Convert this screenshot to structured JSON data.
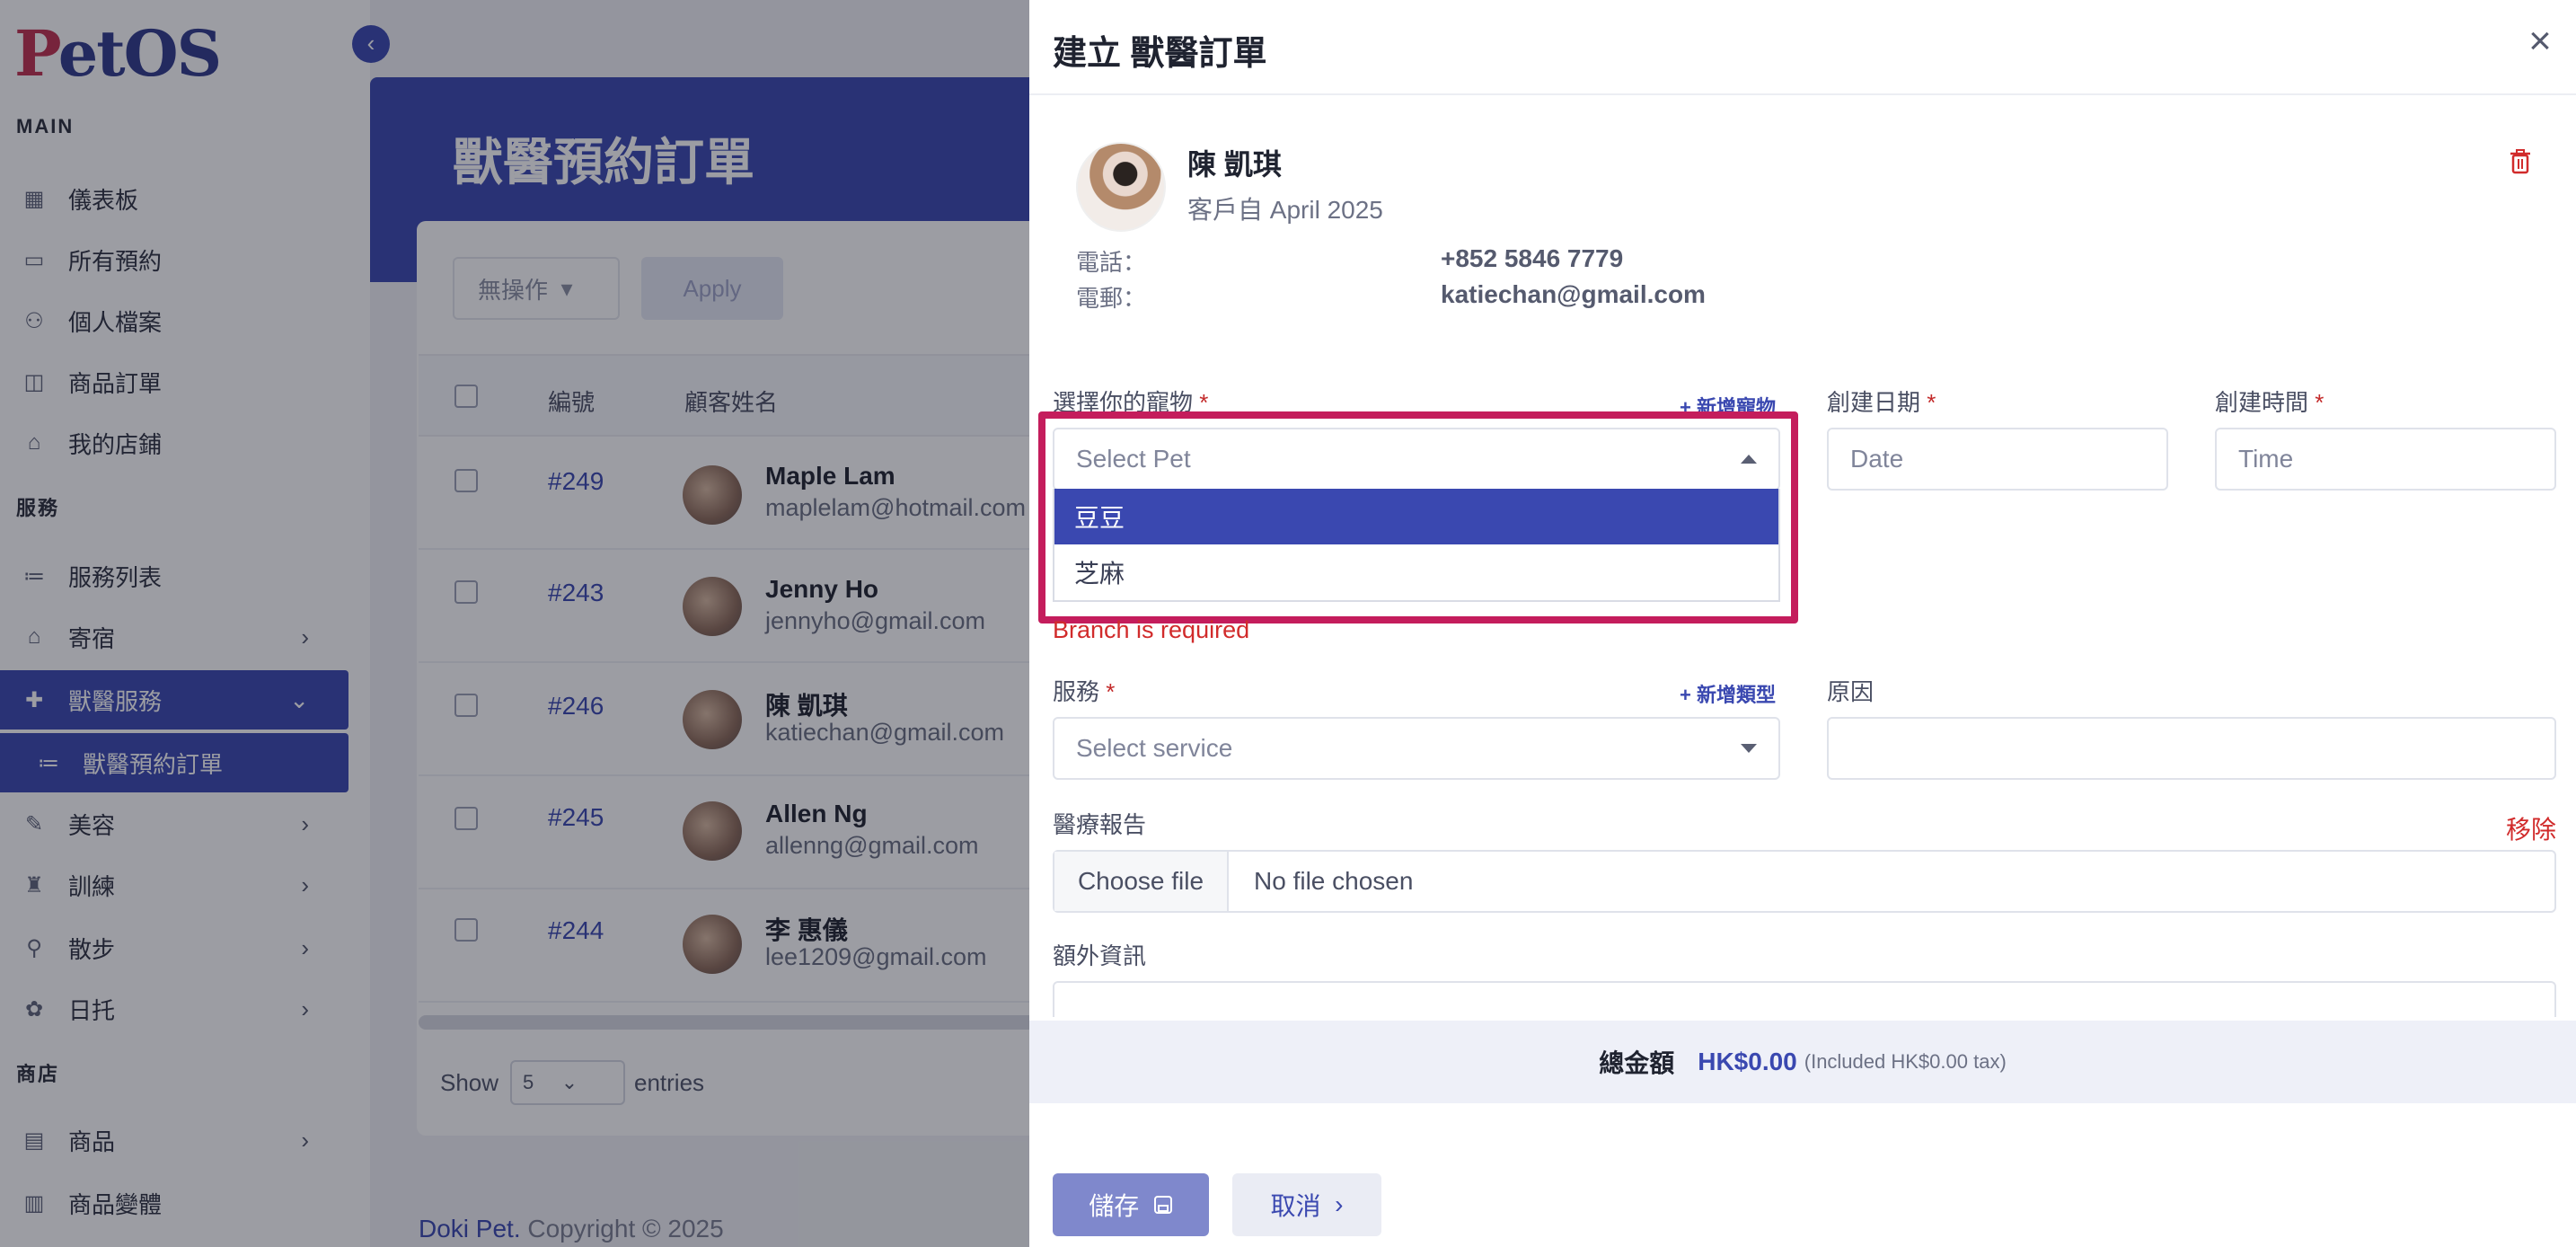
{
  "sidebar": {
    "logo": "PetOS",
    "logo_first": "P",
    "logo_rest": "etOS",
    "sections": {
      "main": "MAIN",
      "services": "服務",
      "shop": "商店"
    },
    "items": [
      {
        "label": "儀表板",
        "icon": "grid-icon"
      },
      {
        "label": "所有預約",
        "icon": "calendar-icon"
      },
      {
        "label": "個人檔案",
        "icon": "user-icon"
      },
      {
        "label": "商品訂單",
        "icon": "bag-icon"
      },
      {
        "label": "我的店鋪",
        "icon": "store-icon"
      },
      {
        "label": "服務列表",
        "icon": "list-icon"
      },
      {
        "label": "寄宿",
        "icon": "home-icon"
      },
      {
        "label": "獸醫服務",
        "icon": "vet-icon"
      },
      {
        "label": "獸醫預約訂單",
        "icon": "list-icon"
      },
      {
        "label": "美容",
        "icon": "brush-icon"
      },
      {
        "label": "訓練",
        "icon": "training-icon"
      },
      {
        "label": "散步",
        "icon": "walk-icon"
      },
      {
        "label": "日托",
        "icon": "daycare-icon"
      },
      {
        "label": "商品",
        "icon": "product-icon"
      },
      {
        "label": "商品變體",
        "icon": "variant-icon"
      }
    ]
  },
  "main": {
    "page_title": "獸醫預約訂單",
    "bulk_action": "無操作",
    "apply": "Apply",
    "columns": [
      "編號",
      "顧客姓名"
    ],
    "rows": [
      {
        "no": "#249",
        "name": "Maple Lam",
        "email": "maplelam@hotmail.com"
      },
      {
        "no": "#243",
        "name": "Jenny Ho",
        "email": "jennyho@gmail.com"
      },
      {
        "no": "#246",
        "name": "陳 凱琪",
        "email": "katiechan@gmail.com"
      },
      {
        "no": "#245",
        "name": "Allen Ng",
        "email": "allenng@gmail.com"
      },
      {
        "no": "#244",
        "name": "李 惠儀",
        "email": "lee1209@gmail.com"
      }
    ],
    "show_label": "Show",
    "entries_value": "5",
    "entries_label": "entries",
    "footer_brand": "Doki Pet.",
    "footer_text": " Copyright © 2025"
  },
  "drawer": {
    "title": "建立 獸醫訂單",
    "customer": {
      "name": "陳 凱琪",
      "since": "客戶自 April 2025",
      "phone_label": "電話：",
      "phone": "+852 5846 7779",
      "email_label": "電郵：",
      "email": "katiechan@gmail.com"
    },
    "pet": {
      "label": "選擇你的寵物",
      "add_link": "+ 新增寵物",
      "placeholder": "Select Pet",
      "options": [
        "豆豆",
        "芝麻"
      ],
      "selected_index": 0,
      "error": "Branch is required"
    },
    "date": {
      "label": "創建日期",
      "placeholder": "Date"
    },
    "time": {
      "label": "創建時間",
      "placeholder": "Time"
    },
    "service": {
      "label": "服務",
      "add_link": "+ 新增類型",
      "placeholder": "Select service"
    },
    "reason": {
      "label": "原因",
      "value": ""
    },
    "report": {
      "label": "醫療報告",
      "remove": "移除",
      "button": "Choose file",
      "status": "No file chosen"
    },
    "extra": {
      "label": "額外資訊"
    },
    "required_mark": "*",
    "total": {
      "label": "總金額",
      "value": "HK$0.00",
      "tax_note": "(Included HK$0.00 tax)"
    },
    "save": "儲存",
    "cancel": "取消"
  },
  "colors": {
    "primary": "#3a48b0",
    "danger": "#d12b2b",
    "highlight": "#c41d5c"
  }
}
